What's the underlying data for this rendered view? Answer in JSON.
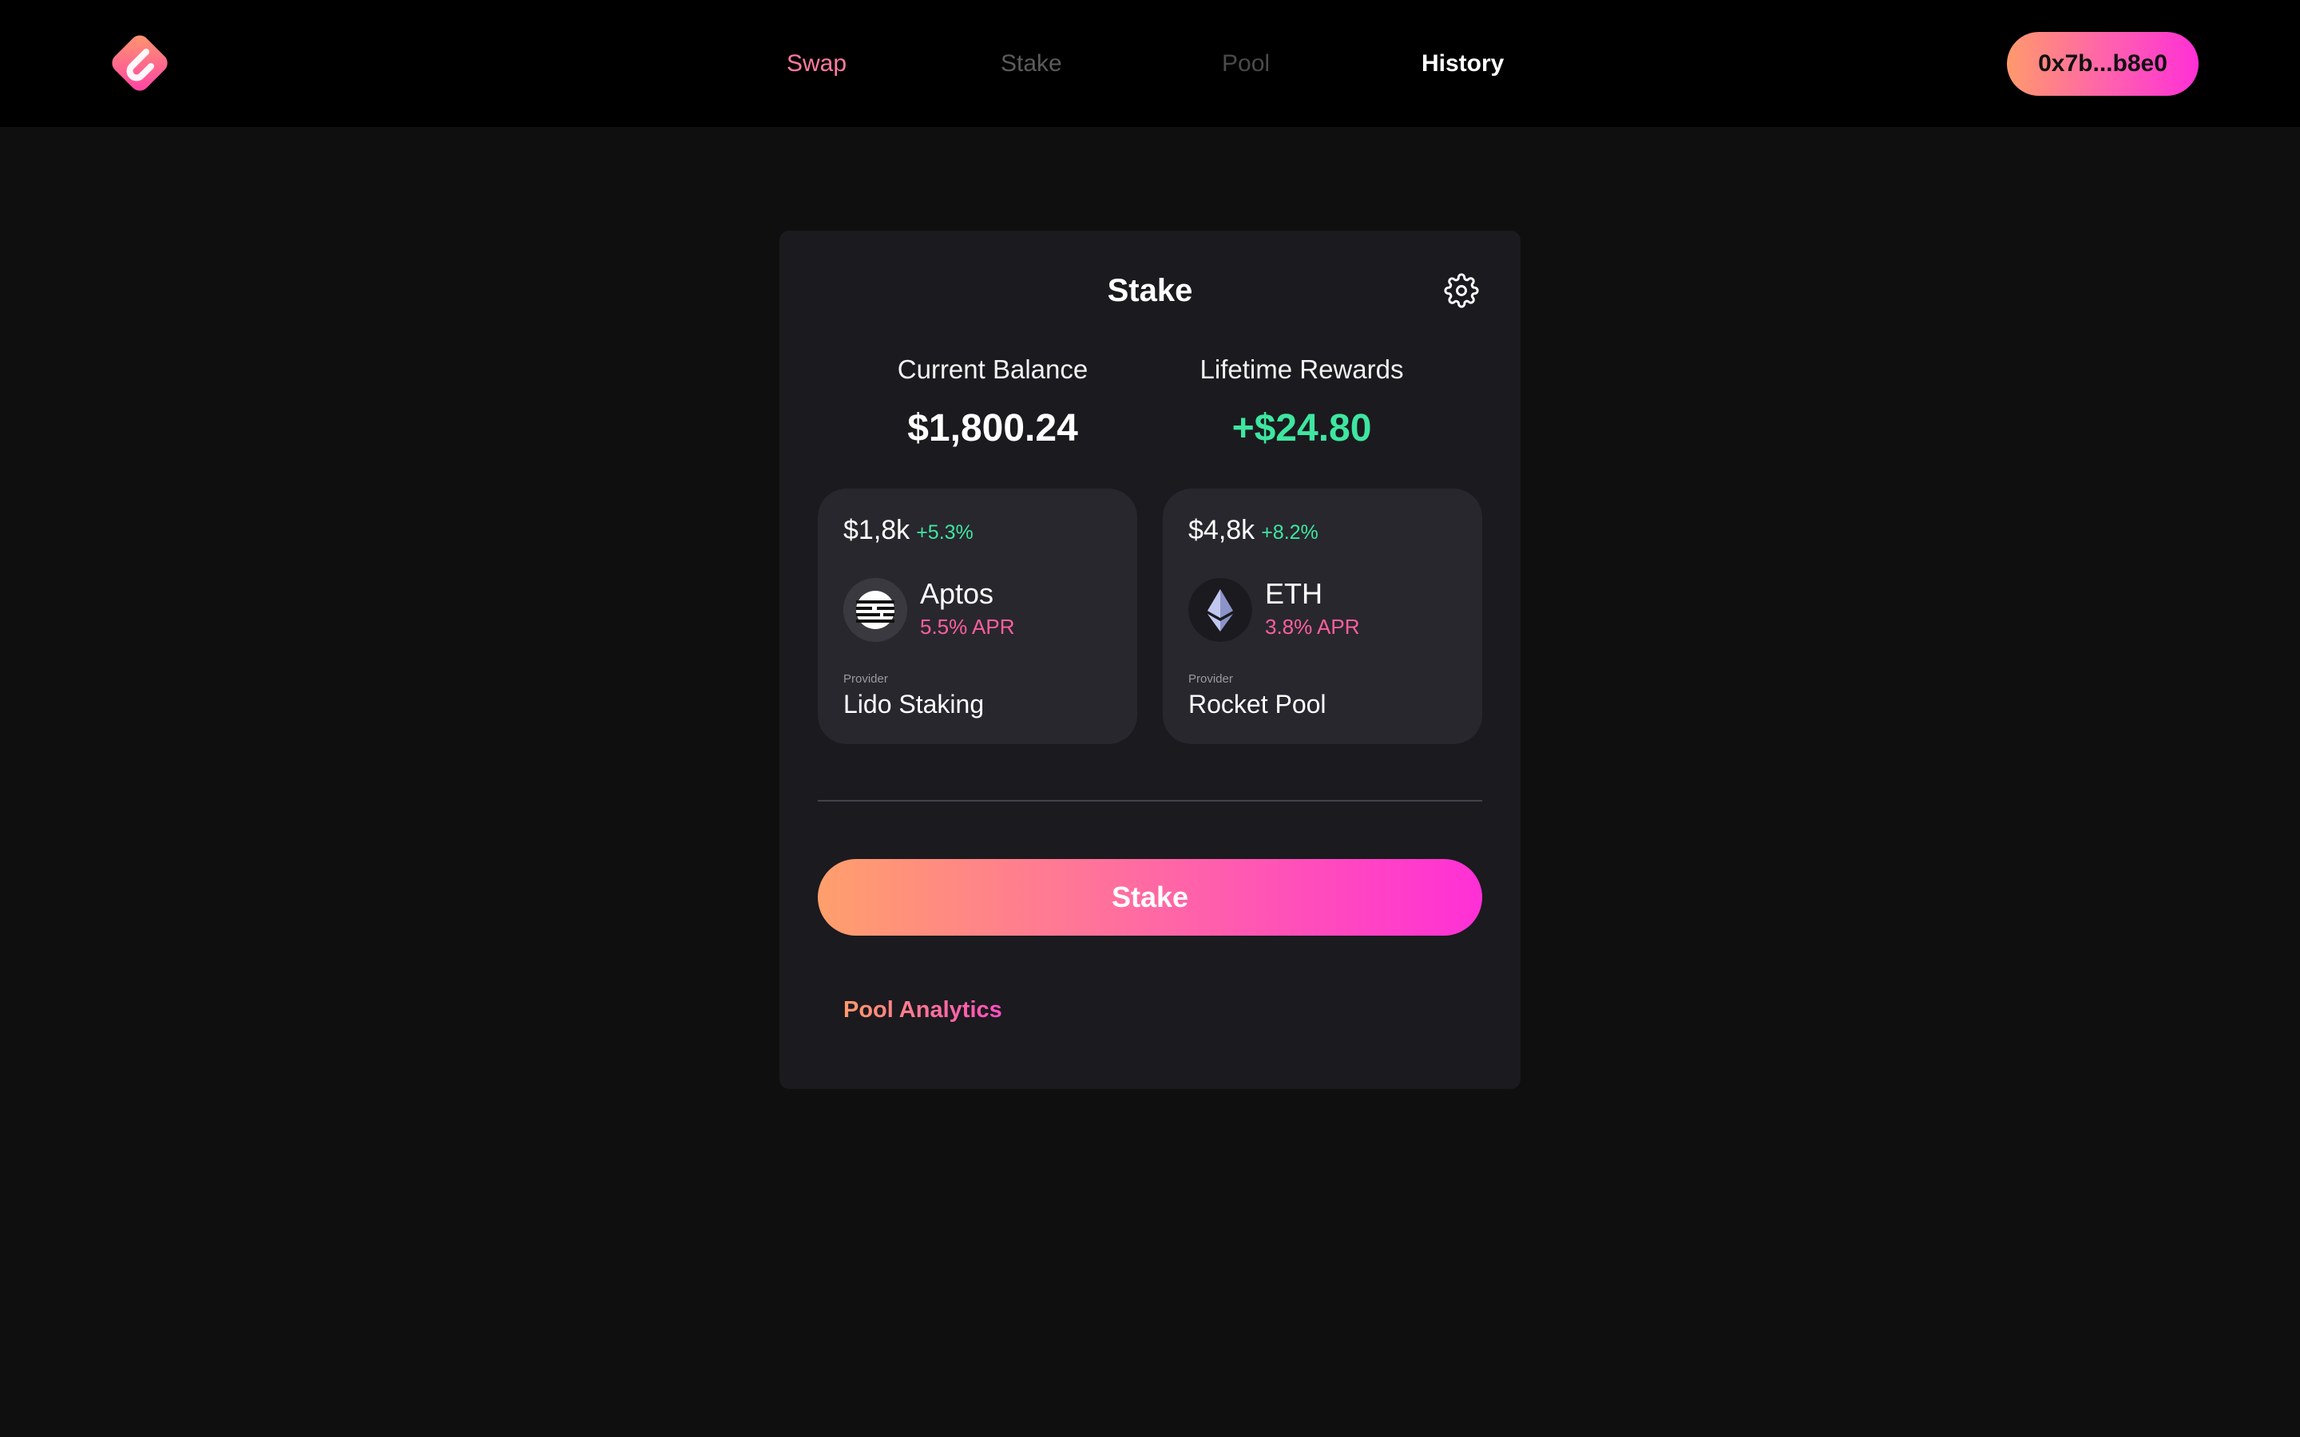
{
  "colors": {
    "background": "#0f0f0f",
    "topbar": "#000000",
    "panel": "#1b1a1f",
    "card": "#28272e",
    "accent_gradient_start": "#ff9a6b",
    "accent_gradient_end": "#ff2fd6",
    "positive": "#3ee6a0",
    "apr": "#ff5f9e"
  },
  "header": {
    "logo_icon": "brand-logo-icon",
    "nav": [
      {
        "label": "Swap",
        "state": "highlighted"
      },
      {
        "label": "Stake",
        "state": "muted"
      },
      {
        "label": "Pool",
        "state": "muted"
      },
      {
        "label": "History",
        "state": "active"
      }
    ],
    "wallet_label": "0x7b...b8e0"
  },
  "panel": {
    "title": "Stake",
    "settings_icon": "gear-icon",
    "balance": {
      "label": "Current Balance",
      "value": "$1,800.24"
    },
    "rewards": {
      "label": "Lifetime Rewards",
      "value": "+$24.80"
    },
    "positions": [
      {
        "amount": "$1,8k",
        "change": "+5.3%",
        "token": "Aptos",
        "token_icon": "aptos-icon",
        "apr": "5.5% APR",
        "provider_caption": "Provider",
        "provider": "Lido Staking"
      },
      {
        "amount": "$4,8k",
        "change": "+8.2%",
        "token": "ETH",
        "token_icon": "ethereum-icon",
        "apr": "3.8% APR",
        "provider_caption": "Provider",
        "provider": "Rocket Pool"
      }
    ],
    "stake_button": "Stake",
    "analytics_link": "Pool Analytics"
  }
}
